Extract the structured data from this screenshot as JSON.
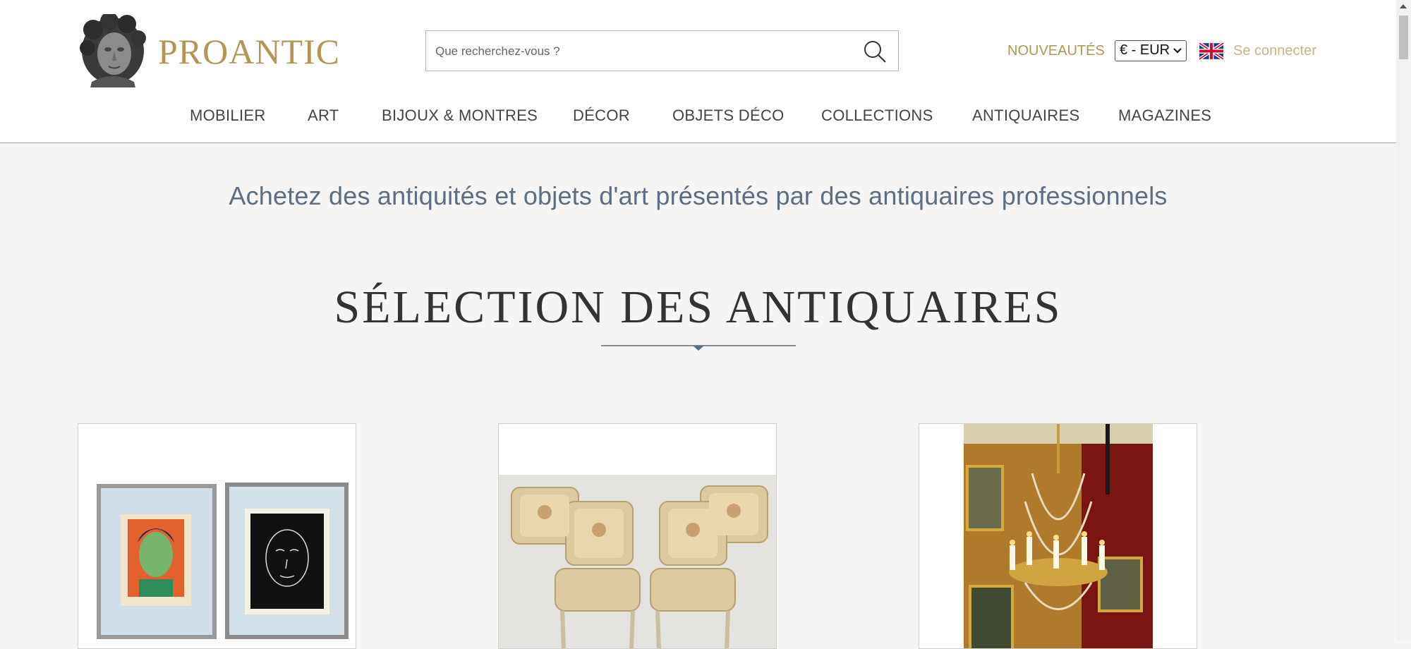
{
  "header": {
    "brand": "PROANTIC",
    "search": {
      "placeholder": "Que recherchez-vous ?"
    },
    "new_link": "NOUVEAUTÉS",
    "currency": "€ - EUR",
    "language_flag": "uk-flag-icon",
    "login": "Se connecter",
    "nav": [
      "MOBILIER",
      "ART",
      "BIJOUX & MONTRES",
      "DÉCOR",
      "OBJETS DÉCO",
      "COLLECTIONS",
      "ANTIQUAIRES",
      "MAGAZINES"
    ]
  },
  "main": {
    "tagline": "Achetez des antiquités et objets d'art présentés par des antiquaires professionnels",
    "section_title": "SÉLECTION DES ANTIQUAIRES",
    "cards": [
      {
        "image": "framed-portrait-prints"
      },
      {
        "image": "four-upholstered-armchairs"
      },
      {
        "image": "crystal-chandelier"
      }
    ]
  },
  "colors": {
    "accent": "#b39656",
    "tagline": "#5a6e85",
    "background": "#f6f5f3"
  }
}
